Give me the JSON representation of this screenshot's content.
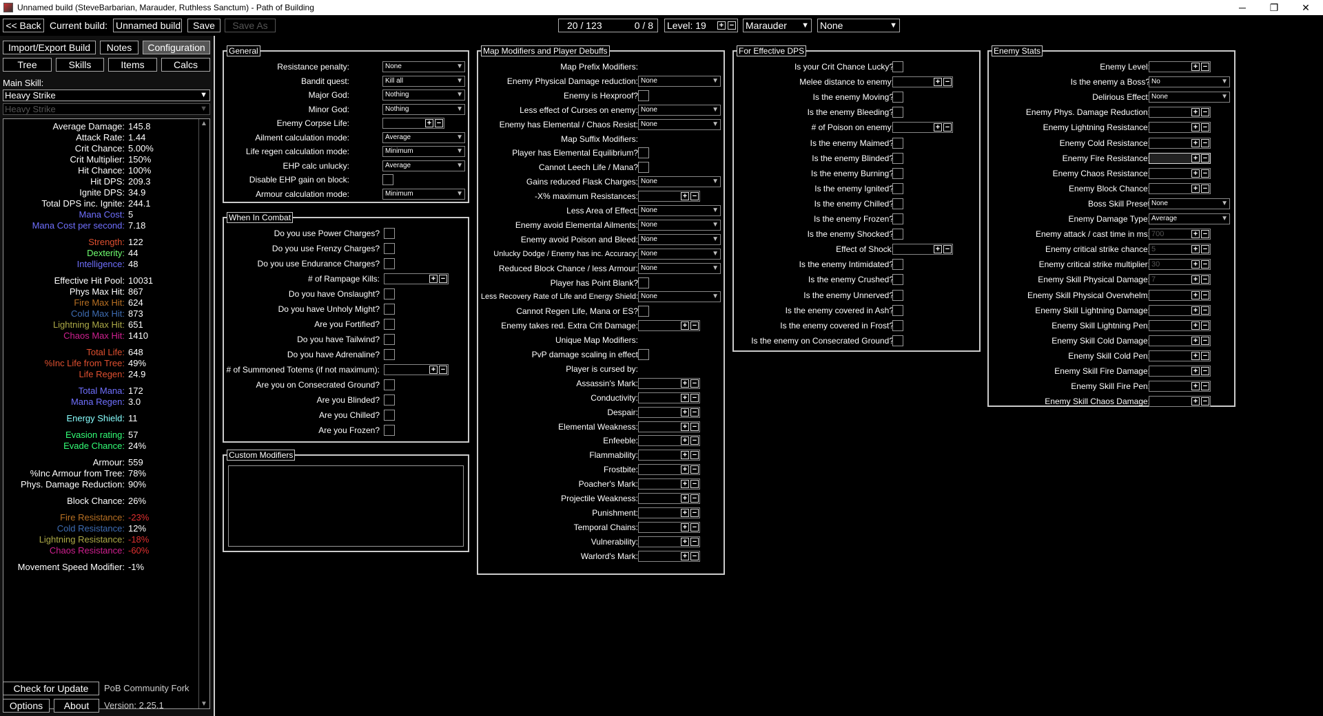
{
  "window": {
    "title": "Unnamed build (SteveBarbarian, Marauder, Ruthless Sanctum) - Path of Building",
    "minimize": "─",
    "maximize": "❐",
    "close": "✕"
  },
  "topbar": {
    "back": "<< Back",
    "current_build_label": "Current build:",
    "build_name": "Unnamed build",
    "save": "Save",
    "save_as": "Save As",
    "points": "20 / 123",
    "asc_points": "0 / 8",
    "level": "Level: 19",
    "class": "Marauder",
    "ascendancy": "None"
  },
  "left": {
    "import_export": "Import/Export Build",
    "notes": "Notes",
    "configuration": "Configuration",
    "tree": "Tree",
    "skills": "Skills",
    "items": "Items",
    "calcs": "Calcs",
    "main_skill_label": "Main Skill:",
    "main_skill": "Heavy Strike",
    "sub_skill": "Heavy Strike",
    "check_update": "Check for Update",
    "fork": "PoB Community Fork",
    "options": "Options",
    "about": "About",
    "version": "Version: 2.25.1"
  },
  "stats": [
    {
      "k": "Average Damage:",
      "v": "145.8",
      "c": ""
    },
    {
      "k": "Attack Rate:",
      "v": "1.44",
      "c": ""
    },
    {
      "k": "Crit Chance:",
      "v": "5.00%",
      "c": ""
    },
    {
      "k": "Crit Multiplier:",
      "v": "150%",
      "c": ""
    },
    {
      "k": "Hit Chance:",
      "v": "100%",
      "c": ""
    },
    {
      "k": "Hit DPS:",
      "v": "209.3",
      "c": ""
    },
    {
      "k": "Ignite DPS:",
      "v": "34.9",
      "c": ""
    },
    {
      "k": "Total DPS inc. Ignite:",
      "v": "244.1",
      "c": ""
    },
    {
      "k": "Mana Cost:",
      "v": "5",
      "c": "c-mana"
    },
    {
      "k": "Mana Cost per second:",
      "v": "7.18",
      "c": "c-mana"
    },
    {
      "k": "Strength:",
      "v": "122",
      "c": "c-str"
    },
    {
      "k": "Dexterity:",
      "v": "44",
      "c": "c-dex"
    },
    {
      "k": "Intelligence:",
      "v": "48",
      "c": "c-int"
    },
    {
      "k": "Effective Hit Pool:",
      "v": "10031",
      "c": ""
    },
    {
      "k": "Phys Max Hit:",
      "v": "867",
      "c": ""
    },
    {
      "k": "Fire Max Hit:",
      "v": "624",
      "c": "c-fire"
    },
    {
      "k": "Cold Max Hit:",
      "v": "873",
      "c": "c-cold"
    },
    {
      "k": "Lightning Max Hit:",
      "v": "651",
      "c": "c-light"
    },
    {
      "k": "Chaos Max Hit:",
      "v": "1410",
      "c": "c-chaos"
    },
    {
      "k": "Total Life:",
      "v": "648",
      "c": "c-life"
    },
    {
      "k": "%Inc Life from Tree:",
      "v": "49%",
      "c": "c-life"
    },
    {
      "k": "Life Regen:",
      "v": "24.9",
      "c": "c-life"
    },
    {
      "k": "Total Mana:",
      "v": "172",
      "c": "c-mana"
    },
    {
      "k": "Mana Regen:",
      "v": "3.0",
      "c": "c-mana"
    },
    {
      "k": "Energy Shield:",
      "v": "11",
      "c": "c-es"
    },
    {
      "k": "Evasion rating:",
      "v": "57",
      "c": "c-eva"
    },
    {
      "k": "Evade Chance:",
      "v": "24%",
      "c": "c-eva"
    },
    {
      "k": "Armour:",
      "v": "559",
      "c": ""
    },
    {
      "k": "%Inc Armour from Tree:",
      "v": "78%",
      "c": ""
    },
    {
      "k": "Phys. Damage Reduction:",
      "v": "90%",
      "c": ""
    },
    {
      "k": "Block Chance:",
      "v": "26%",
      "c": ""
    },
    {
      "k": "Fire Resistance:",
      "v": "-23%",
      "c": "c-fire",
      "vc": "c-neg"
    },
    {
      "k": "Cold Resistance:",
      "v": "12%",
      "c": "c-cold"
    },
    {
      "k": "Lightning Resistance:",
      "v": "-18%",
      "c": "c-light",
      "vc": "c-neg"
    },
    {
      "k": "Chaos Resistance:",
      "v": "-60%",
      "c": "c-chaos",
      "vc": "c-neg"
    },
    {
      "k": "Movement Speed Modifier:",
      "v": "-1%",
      "c": ""
    }
  ],
  "general": {
    "title": "General",
    "rows": [
      {
        "label": "Resistance penalty:",
        "value": "None"
      },
      {
        "label": "Bandit quest:",
        "value": "Kill all"
      },
      {
        "label": "Major God:",
        "value": "Nothing"
      },
      {
        "label": "Minor God:",
        "value": "Nothing"
      },
      {
        "label": "Enemy Corpse Life:",
        "type": "num"
      },
      {
        "label": "Ailment calculation mode:",
        "value": "Average"
      },
      {
        "label": "Life regen calculation mode:",
        "value": "Minimum"
      },
      {
        "label": "EHP calc unlucky:",
        "value": "Average"
      },
      {
        "label": "Disable EHP gain on block:",
        "type": "check"
      },
      {
        "label": "Armour calculation mode:",
        "value": "Minimum"
      }
    ]
  },
  "combat": {
    "title": "When In Combat",
    "rows": [
      "Do you use Power Charges?",
      "Do you use Frenzy Charges?",
      "Do you use Endurance Charges?",
      "# of Rampage Kills:",
      "Do you have Onslaught?",
      "Do you have Unholy Might?",
      "Are you Fortified?",
      "Do you have Tailwind?",
      "Do you have Adrenaline?",
      "# of Summoned Totems (if not maximum):",
      "Are you on Consecrated Ground?",
      "Are you Blinded?",
      "Are you Chilled?",
      "Are you Frozen?"
    ]
  },
  "custom": {
    "title": "Custom Modifiers"
  },
  "map": {
    "title": "Map Modifiers and Player Debuffs",
    "rows": [
      {
        "label": "Map Prefix Modifiers:",
        "type": "none"
      },
      {
        "label": "Enemy Physical Damage reduction:",
        "value": "None"
      },
      {
        "label": "Enemy is Hexproof?",
        "type": "check"
      },
      {
        "label": "Less effect of Curses on enemy:",
        "value": "None"
      },
      {
        "label": "Enemy has Elemental / Chaos Resist:",
        "value": "None"
      },
      {
        "label": "Map Suffix Modifiers:",
        "type": "none"
      },
      {
        "label": "Player has Elemental Equilibrium?",
        "type": "check"
      },
      {
        "label": "Cannot Leech Life / Mana?",
        "type": "check"
      },
      {
        "label": "Gains reduced Flask Charges:",
        "value": "None"
      },
      {
        "label": "-X% maximum Resistances:",
        "type": "num"
      },
      {
        "label": "Less Area of Effect:",
        "value": "None"
      },
      {
        "label": "Enemy avoid Elemental Ailments:",
        "value": "None"
      },
      {
        "label": "Enemy avoid Poison and Bleed:",
        "value": "None"
      },
      {
        "label": "Unlucky Dodge / Enemy has inc. Accuracy:",
        "value": "None"
      },
      {
        "label": "Reduced Block Chance / less Armour:",
        "value": "None"
      },
      {
        "label": "Player has Point Blank?",
        "type": "check"
      },
      {
        "label": "Less Recovery Rate of Life and Energy Shield:",
        "value": "None"
      },
      {
        "label": "Cannot Regen Life, Mana or ES?",
        "type": "check"
      },
      {
        "label": "Enemy takes red. Extra Crit Damage:",
        "type": "num"
      },
      {
        "label": "Unique Map Modifiers:",
        "type": "none"
      },
      {
        "label": "PvP damage scaling in effect",
        "type": "check"
      },
      {
        "label": "Player is cursed by:",
        "type": "none"
      },
      {
        "label": "Assassin's Mark:",
        "type": "num"
      },
      {
        "label": "Conductivity:",
        "type": "num"
      },
      {
        "label": "Despair:",
        "type": "num"
      },
      {
        "label": "Elemental Weakness:",
        "type": "num"
      },
      {
        "label": "Enfeeble:",
        "type": "num"
      },
      {
        "label": "Flammability:",
        "type": "num"
      },
      {
        "label": "Frostbite:",
        "type": "num"
      },
      {
        "label": "Poacher's Mark:",
        "type": "num"
      },
      {
        "label": "Projectile Weakness:",
        "type": "num"
      },
      {
        "label": "Punishment:",
        "type": "num"
      },
      {
        "label": "Temporal Chains:",
        "type": "num"
      },
      {
        "label": "Vulnerability:",
        "type": "num"
      },
      {
        "label": "Warlord's Mark:",
        "type": "num"
      }
    ]
  },
  "dps": {
    "title": "For Effective DPS",
    "rows": [
      {
        "label": "Is your Crit Chance Lucky?",
        "type": "check"
      },
      {
        "label": "Melee distance to enemy:",
        "type": "num"
      },
      {
        "label": "Is the enemy Moving?",
        "type": "check"
      },
      {
        "label": "Is the enemy Bleeding?",
        "type": "check"
      },
      {
        "label": "# of Poison on enemy:",
        "type": "num"
      },
      {
        "label": "Is the enemy Maimed?",
        "type": "check"
      },
      {
        "label": "Is the enemy Blinded?",
        "type": "check"
      },
      {
        "label": "Is the enemy Burning?",
        "type": "check"
      },
      {
        "label": "Is the enemy Ignited?",
        "type": "check"
      },
      {
        "label": "Is the enemy Chilled?",
        "type": "check"
      },
      {
        "label": "Is the enemy Frozen?",
        "type": "check"
      },
      {
        "label": "Is the enemy Shocked?",
        "type": "check"
      },
      {
        "label": "Effect of Shock:",
        "type": "num"
      },
      {
        "label": "Is the enemy Intimidated?",
        "type": "check"
      },
      {
        "label": "Is the enemy Crushed?",
        "type": "check"
      },
      {
        "label": "Is the enemy Unnerved?",
        "type": "check"
      },
      {
        "label": "Is the enemy covered in Ash?",
        "type": "check"
      },
      {
        "label": "Is the enemy covered in Frost?",
        "type": "check"
      },
      {
        "label": "Is the enemy on Consecrated Ground?",
        "type": "check"
      }
    ]
  },
  "enemy": {
    "title": "Enemy Stats",
    "rows": [
      {
        "label": "Enemy Level:",
        "type": "num"
      },
      {
        "label": "Is the enemy a Boss?",
        "value": "No"
      },
      {
        "label": "Delirious Effect:",
        "value": "None"
      },
      {
        "label": "Enemy Phys. Damage Reduction:",
        "type": "num"
      },
      {
        "label": "Enemy Lightning Resistance:",
        "type": "num"
      },
      {
        "label": "Enemy Cold Resistance:",
        "type": "num"
      },
      {
        "label": "Enemy Fire Resistance:",
        "type": "num",
        "hl": true
      },
      {
        "label": "Enemy Chaos Resistance:",
        "type": "num"
      },
      {
        "label": "Enemy Block Chance:",
        "type": "num"
      },
      {
        "label": "Boss Skill Preset",
        "value": "None"
      },
      {
        "label": "Enemy Damage Type:",
        "value": "Average"
      },
      {
        "label": "Enemy attack / cast time in ms:",
        "type": "num",
        "ph": "700"
      },
      {
        "label": "Enemy critical strike chance:",
        "type": "num",
        "ph": "5"
      },
      {
        "label": "Enemy critical strike multiplier:",
        "type": "num",
        "ph": "30"
      },
      {
        "label": "Enemy Skill Physical Damage:",
        "type": "num",
        "ph": "7"
      },
      {
        "label": "Enemy Skill Physical Overwhelm:",
        "type": "num"
      },
      {
        "label": "Enemy Skill Lightning Damage:",
        "type": "num"
      },
      {
        "label": "Enemy Skill Lightning Pen:",
        "type": "num"
      },
      {
        "label": "Enemy Skill Cold Damage:",
        "type": "num"
      },
      {
        "label": "Enemy Skill Cold Pen:",
        "type": "num"
      },
      {
        "label": "Enemy Skill Fire Damage:",
        "type": "num"
      },
      {
        "label": "Enemy Skill Fire Pen:",
        "type": "num"
      },
      {
        "label": "Enemy Skill Chaos Damage:",
        "type": "num"
      }
    ]
  },
  "icons": {
    "plus": "+",
    "minus": "−",
    "dropdown": "▼",
    "scroll_up": "▲",
    "scroll_down": "▼"
  }
}
